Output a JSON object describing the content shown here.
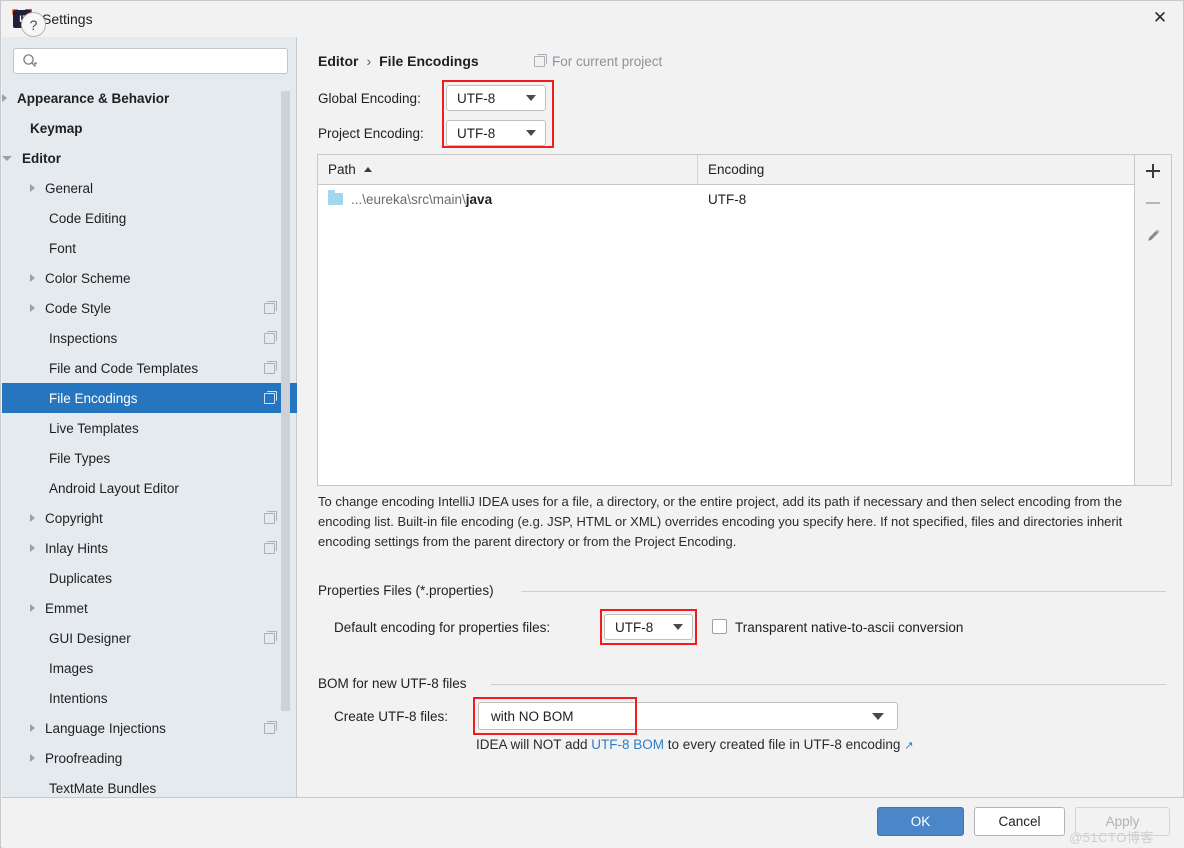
{
  "window": {
    "title": "Settings",
    "logo_icon": "intellij-idea-logo",
    "close_icon": "close-icon"
  },
  "sidebar": {
    "search": {
      "value": "",
      "placeholder": "",
      "icon": "search-icon"
    },
    "items": [
      {
        "label": "Appearance & Behavior",
        "arrow": "collapsed",
        "bold": true,
        "indent": 8,
        "copy": false,
        "selected": false
      },
      {
        "label": "Keymap",
        "arrow": "none",
        "bold": true,
        "indent": 36,
        "copy": false,
        "selected": false
      },
      {
        "label": "Editor",
        "arrow": "expanded",
        "bold": true,
        "indent": 8,
        "copy": false,
        "selected": false
      },
      {
        "label": "General",
        "arrow": "collapsed",
        "bold": false,
        "indent": 36,
        "copy": false,
        "selected": false
      },
      {
        "label": "Code Editing",
        "arrow": "none",
        "bold": false,
        "indent": 55,
        "copy": false,
        "selected": false
      },
      {
        "label": "Font",
        "arrow": "none",
        "bold": false,
        "indent": 55,
        "copy": false,
        "selected": false
      },
      {
        "label": "Color Scheme",
        "arrow": "collapsed",
        "bold": false,
        "indent": 36,
        "copy": false,
        "selected": false
      },
      {
        "label": "Code Style",
        "arrow": "collapsed",
        "bold": false,
        "indent": 36,
        "copy": true,
        "selected": false
      },
      {
        "label": "Inspections",
        "arrow": "none",
        "bold": false,
        "indent": 55,
        "copy": true,
        "selected": false
      },
      {
        "label": "File and Code Templates",
        "arrow": "none",
        "bold": false,
        "indent": 55,
        "copy": true,
        "selected": false
      },
      {
        "label": "File Encodings",
        "arrow": "none",
        "bold": false,
        "indent": 55,
        "copy": true,
        "selected": true
      },
      {
        "label": "Live Templates",
        "arrow": "none",
        "bold": false,
        "indent": 55,
        "copy": false,
        "selected": false
      },
      {
        "label": "File Types",
        "arrow": "none",
        "bold": false,
        "indent": 55,
        "copy": false,
        "selected": false
      },
      {
        "label": "Android Layout Editor",
        "arrow": "none",
        "bold": false,
        "indent": 55,
        "copy": false,
        "selected": false
      },
      {
        "label": "Copyright",
        "arrow": "collapsed",
        "bold": false,
        "indent": 36,
        "copy": true,
        "selected": false
      },
      {
        "label": "Inlay Hints",
        "arrow": "collapsed",
        "bold": false,
        "indent": 36,
        "copy": true,
        "selected": false
      },
      {
        "label": "Duplicates",
        "arrow": "none",
        "bold": false,
        "indent": 55,
        "copy": false,
        "selected": false
      },
      {
        "label": "Emmet",
        "arrow": "collapsed",
        "bold": false,
        "indent": 36,
        "copy": false,
        "selected": false
      },
      {
        "label": "GUI Designer",
        "arrow": "none",
        "bold": false,
        "indent": 55,
        "copy": true,
        "selected": false
      },
      {
        "label": "Images",
        "arrow": "none",
        "bold": false,
        "indent": 55,
        "copy": false,
        "selected": false
      },
      {
        "label": "Intentions",
        "arrow": "none",
        "bold": false,
        "indent": 55,
        "copy": false,
        "selected": false
      },
      {
        "label": "Language Injections",
        "arrow": "collapsed",
        "bold": false,
        "indent": 36,
        "copy": true,
        "selected": false
      },
      {
        "label": "Proofreading",
        "arrow": "collapsed",
        "bold": false,
        "indent": 36,
        "copy": false,
        "selected": false
      },
      {
        "label": "TextMate Bundles",
        "arrow": "none",
        "bold": false,
        "indent": 55,
        "copy": false,
        "selected": false
      }
    ]
  },
  "breadcrumb": {
    "root": "Editor",
    "separator": "›",
    "leaf": "File Encodings",
    "scope_label": "For current project",
    "scope_icon": "copy-config-icon"
  },
  "encoding": {
    "global_label": "Global Encoding:",
    "global_value": "UTF-8",
    "project_label": "Project Encoding:",
    "project_value": "UTF-8"
  },
  "table": {
    "columns": [
      "Path",
      "Encoding"
    ],
    "sort_column": "Path",
    "sort_direction": "asc",
    "rows": [
      {
        "path_prefix": "...\\eureka\\src\\main\\",
        "path_leaf": "java",
        "encoding": "UTF-8",
        "icon": "folder-icon"
      }
    ],
    "toolbar": [
      {
        "icon": "plus-icon",
        "enabled": true
      },
      {
        "icon": "minus-icon",
        "enabled": false
      },
      {
        "icon": "edit-pencil-icon",
        "enabled": false
      }
    ]
  },
  "description": "To change encoding IntelliJ IDEA uses for a file, a directory, or the entire project, add its path if necessary and then select encoding from the encoding list. Built-in file encoding (e.g. JSP, HTML or XML) overrides encoding you specify here. If not specified, files and directories inherit encoding settings from the parent directory or from the Project Encoding.",
  "properties_section": {
    "title": "Properties Files (*.properties)",
    "default_encoding_label": "Default encoding for properties files:",
    "default_encoding_value": "UTF-8",
    "transparent_checkbox_label": "Transparent native-to-ascii conversion",
    "transparent_checked": false
  },
  "bom_section": {
    "title": "BOM for new UTF-8 files",
    "create_label": "Create UTF-8 files:",
    "create_value": "with NO BOM",
    "note_before": "IDEA will NOT add ",
    "note_link": "UTF-8 BOM",
    "note_after": " to every created file in UTF-8 encoding",
    "note_external_icon": "↗"
  },
  "footer": {
    "help_label": "?",
    "ok_label": "OK",
    "cancel_label": "Cancel",
    "apply_label": "Apply",
    "apply_enabled": false,
    "watermark": "@51CTO博客"
  },
  "colors": {
    "selection_blue": "#2675bf",
    "primary_button": "#4a86c8",
    "highlight_red": "#ef1d1d",
    "link_blue": "#2f7ec4",
    "sidebar_bg": "#e5eaef"
  }
}
